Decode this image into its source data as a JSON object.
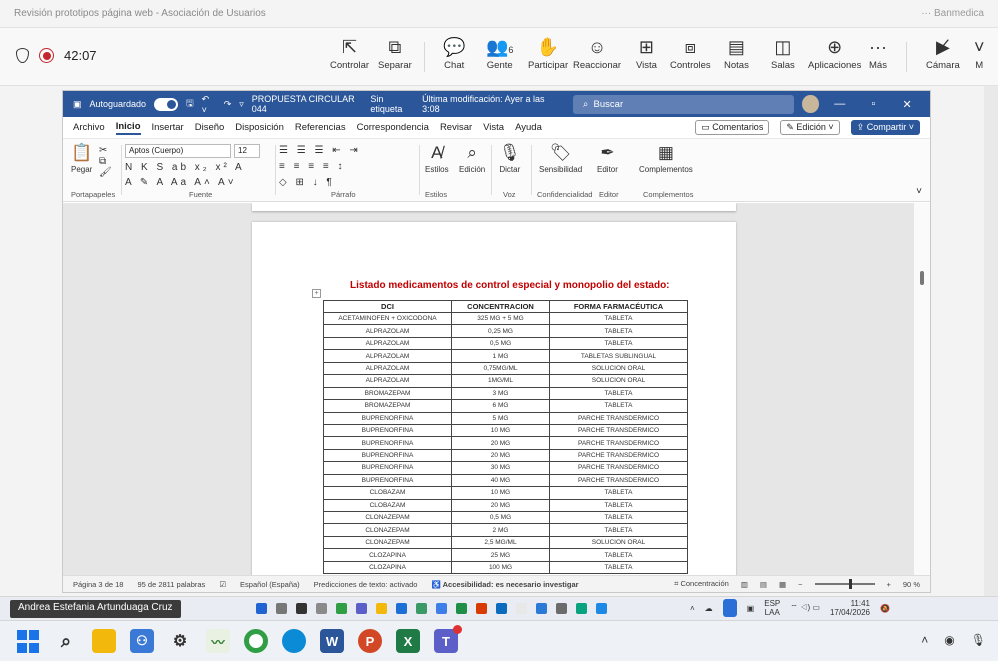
{
  "window_title": "Revisión prototipos página web - Asociación de Usuarios",
  "window_title_right": "··· Banmedica",
  "meeting": {
    "timer": "42:07",
    "people_count": "6",
    "tools": [
      "Controlar",
      "Separar",
      "Chat",
      "Gente",
      "Participar",
      "Reaccionar",
      "Vista",
      "Controles",
      "Notas",
      "Salas",
      "Aplicaciones",
      "Más",
      "Cámara"
    ],
    "mic_label": "M"
  },
  "word": {
    "autosave_label": "Autoguardado",
    "doc_title": "PROPUESTA CIRCULAR 044",
    "sensitivity": "Sin etiqueta",
    "last_modified": "Última modificación: Ayer a las 3:08",
    "search_placeholder": "Buscar",
    "menus": [
      "Archivo",
      "Inicio",
      "Insertar",
      "Diseño",
      "Disposición",
      "Referencias",
      "Correspondencia",
      "Revisar",
      "Vista",
      "Ayuda"
    ],
    "comments_btn": "Comentarios",
    "edit_btn": "Edición",
    "share_btn": "Compartir",
    "ribbon": {
      "paste": "Pegar",
      "font_name": "Aptos (Cuerpo)",
      "font_size": "12",
      "styles": "Estilos",
      "editing": "Edición",
      "dictate": "Dictar",
      "sensitivity": "Sensibilidad",
      "editor": "Editor",
      "complements": "Complementos",
      "groups": [
        "Portapapeles",
        "Fuente",
        "Párrafo",
        "Estilos",
        "Voz",
        "Confidencialidad",
        "Editor",
        "Complementos"
      ]
    },
    "document": {
      "heading": "Listado medicamentos de control especial y monopolio del estado:",
      "columns": [
        "DCI",
        "CONCENTRACION",
        "FORMA FARMACÉUTICA"
      ],
      "rows": [
        [
          "ACETAMINOFEN + OXICODONA",
          "325 MG + 5 MG",
          "TABLETA"
        ],
        [
          "ALPRAZOLAM",
          "0,25 MG",
          "TABLETA"
        ],
        [
          "ALPRAZOLAM",
          "0,5 MG",
          "TABLETA"
        ],
        [
          "ALPRAZOLAM",
          "1 MG",
          "TABLETAS SUBLINGUAL"
        ],
        [
          "ALPRAZOLAM",
          "0,75MG/ML",
          "SOLUCION ORAL"
        ],
        [
          "ALPRAZOLAM",
          "1MG/ML",
          "SOLUCION ORAL"
        ],
        [
          "BROMAZEPAM",
          "3 MG",
          "TABLETA"
        ],
        [
          "BROMAZEPAM",
          "6 MG",
          "TABLETA"
        ],
        [
          "BUPRENORFINA",
          "5 MG",
          "PARCHE TRANSDERMICO"
        ],
        [
          "BUPRENORFINA",
          "10 MG",
          "PARCHE TRANSDERMICO"
        ],
        [
          "BUPRENORFINA",
          "20 MG",
          "PARCHE TRANSDERMICO"
        ],
        [
          "BUPRENORFINA",
          "20 MG",
          "PARCHE TRANSDERMICO"
        ],
        [
          "BUPRENORFINA",
          "30 MG",
          "PARCHE TRANSDERMICO"
        ],
        [
          "BUPRENORFINA",
          "40 MG",
          "PARCHE TRANSDERMICO"
        ],
        [
          "CLOBAZAM",
          "10 MG",
          "TABLETA"
        ],
        [
          "CLOBAZAM",
          "20 MG",
          "TABLETA"
        ],
        [
          "CLONAZEPAM",
          "0,5 MG",
          "TABLETA"
        ],
        [
          "CLONAZEPAM",
          "2 MG",
          "TABLETA"
        ],
        [
          "CLONAZEPAM",
          "2,5 MG/ML",
          "SOLUCION ORAL"
        ],
        [
          "CLOZAPINA",
          "25 MG",
          "TABLETA"
        ],
        [
          "CLOZAPINA",
          "100 MG",
          "TABLETA"
        ]
      ]
    },
    "status": {
      "page": "Página 3 de 18",
      "words": "95 de 2811 palabras",
      "language": "Español (España)",
      "predictions": "Predicciones de texto: activado",
      "accessibility": "Accesibilidad: es necesario investigar",
      "focus": "Concentración",
      "zoom": "90 %"
    }
  },
  "presenter": "Andrea Estefania Artunduaga Cruz",
  "remote_tray": {
    "lang_top": "ESP",
    "lang_bottom": "LAA",
    "time": "11:41",
    "date": "17/04/2026"
  },
  "colors": {
    "word_blue": "#2b569a",
    "heading_red": "#c00000",
    "record_red": "#c4262e"
  }
}
